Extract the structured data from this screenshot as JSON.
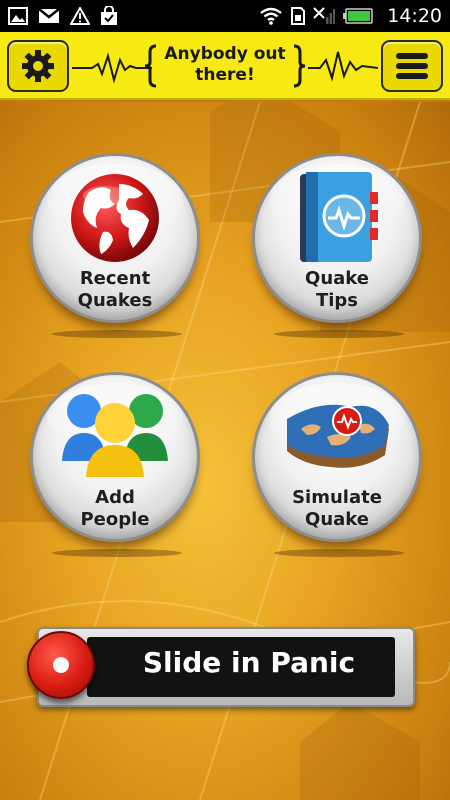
{
  "status_bar": {
    "time": "14:20",
    "left_icons": [
      "gallery-icon",
      "gmail-icon",
      "warning-icon",
      "shopping-bag-icon"
    ],
    "right_icons": [
      "wifi-icon",
      "sim-icon",
      "signal-icon",
      "battery-icon"
    ]
  },
  "header": {
    "title": "Anybody out there!",
    "title_line1": "Anybody out",
    "title_line2": "there!",
    "settings_icon": "gear-icon",
    "menu_icon": "hamburger-menu-icon",
    "bg_color": "#f6ea12"
  },
  "grid": [
    {
      "id": "recent",
      "line1": "Recent",
      "line2": "Quakes",
      "icon": "globe-icon"
    },
    {
      "id": "tips",
      "line1": "Quake",
      "line2": "Tips",
      "icon": "book-icon"
    },
    {
      "id": "add",
      "line1": "Add",
      "line2": "People",
      "icon": "people-icon"
    },
    {
      "id": "sim",
      "line1": "Simulate",
      "line2": "Quake",
      "icon": "map-icon"
    }
  ],
  "slider": {
    "label": "Slide in Panic",
    "knob_color": "#d81c12"
  }
}
